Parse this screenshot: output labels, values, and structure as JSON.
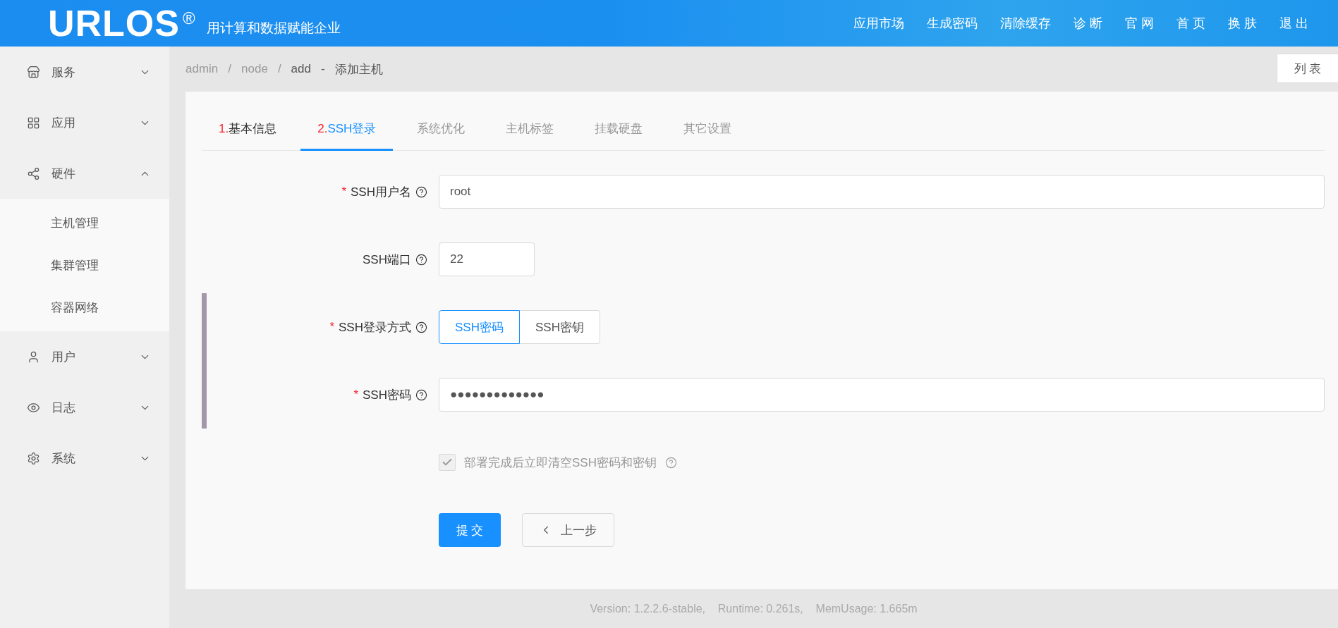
{
  "header": {
    "logo": "URLOS",
    "logo_mark": "®",
    "tagline": "用计算和数据赋能企业",
    "nav": [
      "应用市场",
      "生成密码",
      "清除缓存",
      "诊 断",
      "官 网",
      "首 页",
      "换 肤",
      "退 出"
    ]
  },
  "sidebar": {
    "items": [
      {
        "label": "服务",
        "expanded": false
      },
      {
        "label": "应用",
        "expanded": false
      },
      {
        "label": "硬件",
        "expanded": true,
        "children": [
          {
            "label": "主机管理"
          },
          {
            "label": "集群管理"
          },
          {
            "label": "容器网络"
          }
        ]
      },
      {
        "label": "用户",
        "expanded": false
      },
      {
        "label": "日志",
        "expanded": false
      },
      {
        "label": "系统",
        "expanded": false
      }
    ]
  },
  "breadcrumb": {
    "items": [
      "admin",
      "node",
      "add"
    ],
    "separator": "/",
    "title_separator": "-",
    "title": "添加主机"
  },
  "list_button": "列 表",
  "tabs": [
    {
      "step": "1.",
      "label": "基本信息",
      "selected": false,
      "disabled": false
    },
    {
      "step": "2.",
      "label": "SSH登录",
      "selected": true,
      "disabled": false
    },
    {
      "label": "系统优化",
      "selected": false,
      "disabled": true
    },
    {
      "label": "主机标签",
      "selected": false,
      "disabled": true
    },
    {
      "label": "挂载硬盘",
      "selected": false,
      "disabled": true
    },
    {
      "label": "其它设置",
      "selected": false,
      "disabled": true
    }
  ],
  "form": {
    "fields": [
      {
        "kind": "text",
        "label": "SSH用户名",
        "required_mark": "*",
        "grouped": false,
        "value": "root"
      },
      {
        "kind": "short",
        "label": "SSH端口",
        "grouped": false,
        "value": "22"
      },
      {
        "kind": "radio",
        "label": "SSH登录方式",
        "required_mark": "*",
        "grouped": true,
        "options": [
          {
            "label": "SSH密码",
            "selected": true
          },
          {
            "label": "SSH密钥",
            "selected": false
          }
        ]
      },
      {
        "kind": "password",
        "label": "SSH密码",
        "required_mark": "*",
        "grouped": true,
        "value": "●●●●●●●●●●●●●"
      }
    ],
    "checkbox": {
      "label": "部署完成后立即清空SSH密码和密钥",
      "checked": true,
      "disabled": true
    },
    "buttons": {
      "submit": "提 交",
      "back": "上一步"
    }
  },
  "footer": "Version: 1.2.2.6-stable,    Runtime: 0.261s,    MemUsage: 1.665m"
}
